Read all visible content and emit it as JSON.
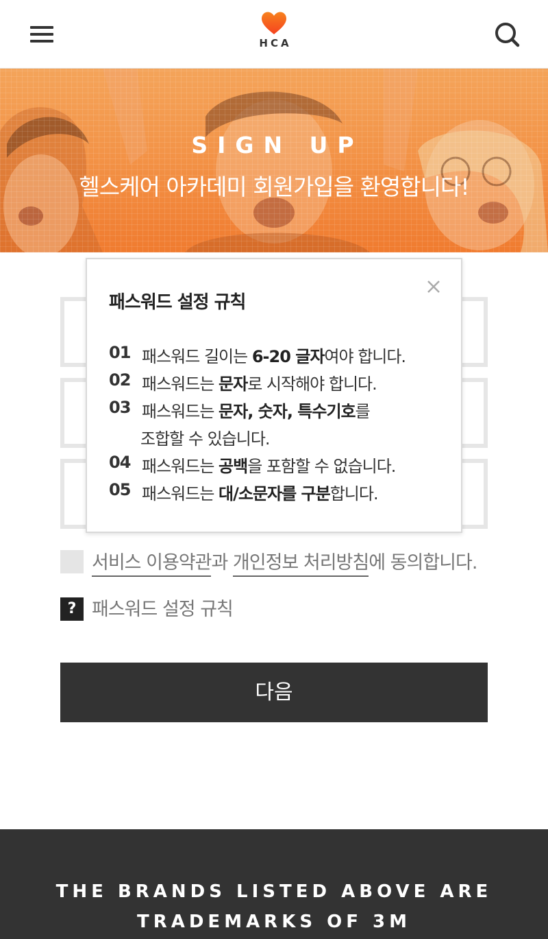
{
  "header": {
    "logo_text": "HCA",
    "menu_icon": "hamburger-icon",
    "search_icon": "search-icon",
    "brand_color": "#f5521f"
  },
  "hero": {
    "title": "SIGN UP",
    "subtitle": "헬스케어 아카데미 회원가입을 환영합니다!",
    "overlay_color": "#f39448"
  },
  "agreement": {
    "terms_link": "서비스 이용약관",
    "connector": "과 ",
    "privacy_link": "개인정보 처리방침",
    "suffix": "에 동의합니다."
  },
  "password_rule_link": "패스워드 설정 규칙",
  "help_icon_label": "?",
  "next_button": "다음",
  "footer": {
    "line1": "THE BRANDS LISTED ABOVE ARE",
    "line2": "TRADEMARKS OF 3M"
  },
  "modal": {
    "title": "패스워드 설정 규칙",
    "close_icon": "close-icon",
    "rules": [
      {
        "num": "01",
        "pre": "패스워드 길이는 ",
        "bold": "6-20 글자",
        "post": "여야 합니다."
      },
      {
        "num": "02",
        "pre": "패스워드는 ",
        "bold": "문자",
        "post": "로 시작해야 합니다."
      },
      {
        "num": "03",
        "pre": "패스워드는 ",
        "bold": "문자, 숫자, 특수기호",
        "post": "를",
        "cont": "조합할 수 있습니다."
      },
      {
        "num": "04",
        "pre": "패스워드는 ",
        "bold": "공백",
        "post": "을 포함할 수 없습니다."
      },
      {
        "num": "05",
        "pre": "패스워드는 ",
        "bold": "대/소문자를 구분",
        "post": "합니다."
      }
    ]
  }
}
